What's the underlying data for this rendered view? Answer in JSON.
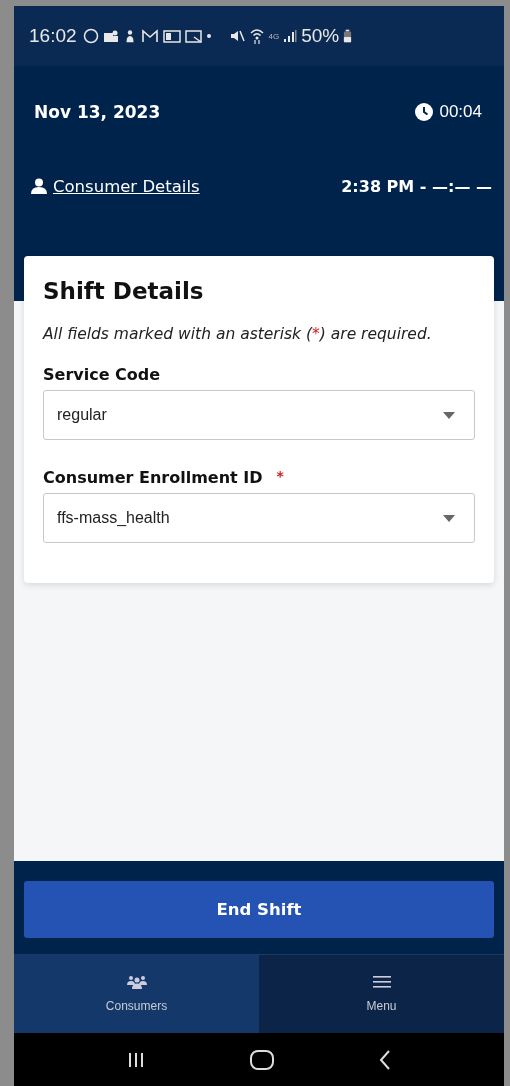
{
  "status_bar": {
    "time": "16:02",
    "battery": "50%",
    "network": "4G"
  },
  "header": {
    "date": "Nov 13, 2023",
    "timer": "00:04",
    "link": "Consumer Details",
    "shift_time": "2:38 PM - —:— —"
  },
  "card": {
    "title": "Shift Details",
    "note": {
      "before": "All fields marked with an asterisk (",
      "mark": "*",
      "after": ") are required."
    },
    "fields": [
      {
        "label": "Service Code",
        "required": false,
        "value": "regular"
      },
      {
        "label": "Consumer Enrollment ID",
        "required": true,
        "value": "ffs-mass_health"
      }
    ]
  },
  "primary_button": "End Shift",
  "tabs": [
    {
      "label": "Consumers",
      "kind": "people",
      "selected": true
    },
    {
      "label": "Menu",
      "kind": "menu",
      "selected": false
    }
  ]
}
